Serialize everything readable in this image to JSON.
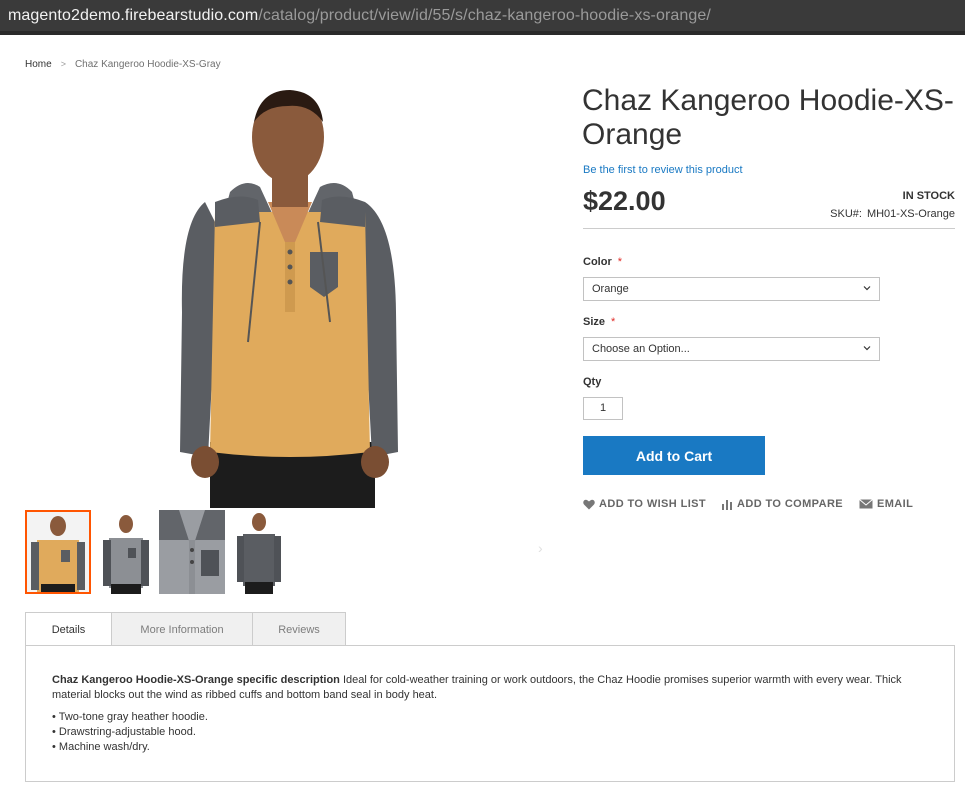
{
  "browser": {
    "url_host": "magento2demo.firebearstudio.com",
    "url_path": "/catalog/product/view/id/55/s/chaz-kangeroo-hoodie-xs-orange/"
  },
  "breadcrumb": {
    "home": "Home",
    "separator": ">",
    "current": "Chaz Kangeroo Hoodie-XS-Gray"
  },
  "product": {
    "title": "Chaz Kangeroo Hoodie-XS-Orange",
    "review_link": "Be the first to review this product",
    "price": "$22.00",
    "stock": "IN STOCK",
    "sku_label": "SKU#:",
    "sku_value": "MH01-XS-Orange"
  },
  "options": {
    "color_label": "Color",
    "color_value": "Orange",
    "size_label": "Size",
    "size_value": "Choose an Option...",
    "required_marker": "*",
    "qty_label": "Qty",
    "qty_value": "1"
  },
  "buttons": {
    "add_to_cart": "Add to Cart",
    "wish_list": "Add to Wish List",
    "compare": "Add to Compare",
    "email": "Email"
  },
  "tabs": [
    {
      "label": "Details",
      "active": true
    },
    {
      "label": "More Information",
      "active": false
    },
    {
      "label": "Reviews",
      "active": false
    }
  ],
  "details": {
    "description_bold": "Chaz Kangeroo Hoodie-XS-Orange specific description",
    "description_text": " Ideal for cold-weather training or work outdoors, the Chaz Hoodie promises superior warmth with every wear. Thick material blocks out the wind as ribbed cuffs and bottom band seal in body heat.",
    "bullets": [
      "Two-tone gray heather hoodie.",
      "Drawstring-adjustable hood.",
      "Machine wash/dry."
    ]
  },
  "colors": {
    "accent_blue": "#1979c3",
    "active_thumb_border": "#ff5501",
    "required_red": "#e02b27",
    "hoodie_orange": "#e0aa5c",
    "hoodie_gray": "#5a5d62"
  }
}
